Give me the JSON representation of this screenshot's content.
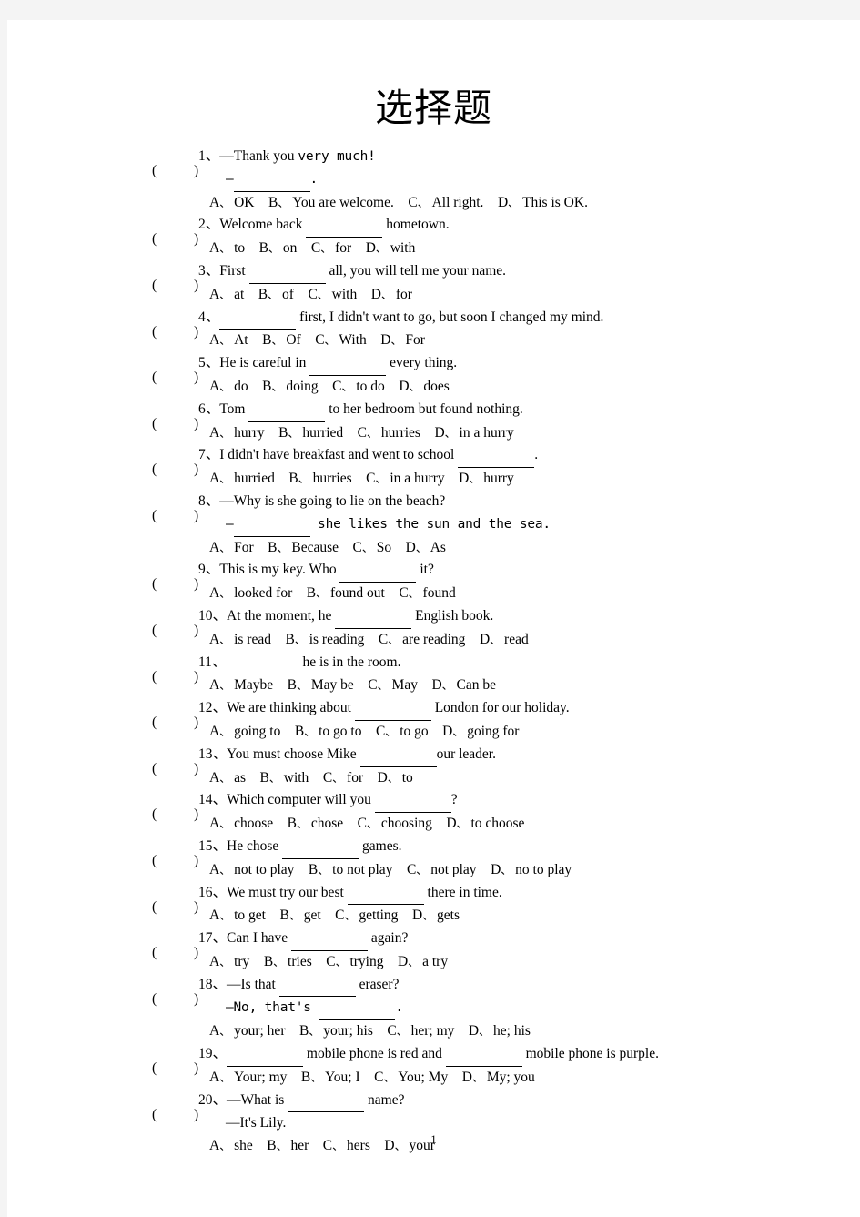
{
  "document": {
    "title": "选择题",
    "page_number": "1",
    "paren_left": "(",
    "paren_right": ")",
    "option_separator": "、"
  },
  "questions": [
    {
      "number": "1、",
      "stem": "—Thank you ",
      "stem_mono": "very much!",
      "continuation_prefix": "—",
      "continuation_suffix": ".",
      "options": [
        {
          "letter": "A",
          "text": "OK"
        },
        {
          "letter": "B",
          "text": "You are welcome."
        },
        {
          "letter": "C",
          "text": "All right."
        },
        {
          "letter": "D",
          "text": "This is OK."
        }
      ]
    },
    {
      "number": "2、",
      "stem_before": "Welcome back ",
      "stem_after": " hometown.",
      "options": [
        {
          "letter": "A",
          "text": "to"
        },
        {
          "letter": "B",
          "text": "on"
        },
        {
          "letter": "C",
          "text": "for"
        },
        {
          "letter": "D",
          "text": "with"
        }
      ]
    },
    {
      "number": "3、",
      "stem_before": "First ",
      "stem_after": " all, you will tell me your name.",
      "options": [
        {
          "letter": "A",
          "text": "at"
        },
        {
          "letter": "B",
          "text": "of"
        },
        {
          "letter": "C",
          "text": "with"
        },
        {
          "letter": "D",
          "text": "for"
        }
      ]
    },
    {
      "number": "4、",
      "stem_before": "",
      "stem_after": " first, I didn't want to go, but soon I changed my mind.",
      "options": [
        {
          "letter": "A",
          "text": "At"
        },
        {
          "letter": "B",
          "text": "Of"
        },
        {
          "letter": "C",
          "text": "With"
        },
        {
          "letter": "D",
          "text": "For"
        }
      ]
    },
    {
      "number": "5、",
      "stem_before": "He is careful in ",
      "stem_after": " every thing.",
      "options": [
        {
          "letter": "A",
          "text": "do"
        },
        {
          "letter": "B",
          "text": "doing"
        },
        {
          "letter": "C",
          "text": "to do"
        },
        {
          "letter": "D",
          "text": "does"
        }
      ]
    },
    {
      "number": "6、",
      "stem_before": "Tom ",
      "stem_after": " to her bedroom but found nothing.",
      "options": [
        {
          "letter": "A",
          "text": "hurry"
        },
        {
          "letter": "B",
          "text": "hurried"
        },
        {
          "letter": "C",
          "text": "hurries"
        },
        {
          "letter": "D",
          "text": "in a hurry"
        }
      ]
    },
    {
      "number": "7、",
      "stem_before": "I didn't have breakfast and went to school ",
      "stem_after": ".",
      "options": [
        {
          "letter": "A",
          "text": "hurried"
        },
        {
          "letter": "B",
          "text": "hurries"
        },
        {
          "letter": "C",
          "text": "in a hurry"
        },
        {
          "letter": "D",
          "text": "hurry"
        }
      ]
    },
    {
      "number": "8、",
      "stem": "—Why is she going to lie on the beach?",
      "continuation_prefix": "—",
      "continuation_suffix": " she likes the sun and the sea.",
      "options": [
        {
          "letter": "A",
          "text": "For"
        },
        {
          "letter": "B",
          "text": "Because"
        },
        {
          "letter": "C",
          "text": "So"
        },
        {
          "letter": "D",
          "text": "As"
        }
      ]
    },
    {
      "number": "9、",
      "stem_before": "This is my key. Who ",
      "stem_after": " it?",
      "options": [
        {
          "letter": "A",
          "text": "looked for"
        },
        {
          "letter": "B",
          "text": "found out"
        },
        {
          "letter": "C",
          "text": "found"
        }
      ]
    },
    {
      "number": "10、",
      "stem_before": "At the moment, he ",
      "stem_after": " English book.",
      "options": [
        {
          "letter": "A",
          "text": "is read"
        },
        {
          "letter": "B",
          "text": "is reading"
        },
        {
          "letter": "C",
          "text": "are reading"
        },
        {
          "letter": "D",
          "text": "read"
        }
      ]
    },
    {
      "number": "11、",
      "stem_before": "",
      "stem_after": "he is in the room.",
      "options": [
        {
          "letter": "A",
          "text": "Maybe"
        },
        {
          "letter": "B",
          "text": "May be"
        },
        {
          "letter": "C",
          "text": "May"
        },
        {
          "letter": "D",
          "text": "Can be"
        }
      ]
    },
    {
      "number": "12、",
      "stem_before": "We are thinking about ",
      "stem_after": " London for our holiday.",
      "options": [
        {
          "letter": "A",
          "text": "going to"
        },
        {
          "letter": "B",
          "text": "to go to"
        },
        {
          "letter": "C",
          "text": "to go"
        },
        {
          "letter": "D",
          "text": "going for"
        }
      ]
    },
    {
      "number": "13、",
      "stem_before": "You must choose Mike ",
      "stem_after": "our leader.",
      "options": [
        {
          "letter": "A",
          "text": "as"
        },
        {
          "letter": "B",
          "text": "with"
        },
        {
          "letter": "C",
          "text": "for"
        },
        {
          "letter": "D",
          "text": "to"
        }
      ]
    },
    {
      "number": "14、",
      "stem_before": "Which computer will you ",
      "stem_after": "?",
      "options": [
        {
          "letter": "A",
          "text": "choose"
        },
        {
          "letter": "B",
          "text": "chose"
        },
        {
          "letter": "C",
          "text": "choosing"
        },
        {
          "letter": "D",
          "text": "to choose"
        }
      ]
    },
    {
      "number": "15、",
      "stem_before": "He chose ",
      "stem_after": " games.",
      "options": [
        {
          "letter": "A",
          "text": "not to play"
        },
        {
          "letter": "B",
          "text": "to not play"
        },
        {
          "letter": "C",
          "text": "not play"
        },
        {
          "letter": "D",
          "text": "no to play"
        }
      ]
    },
    {
      "number": "16、",
      "stem_before": "We must try our best ",
      "stem_after": " there in time.",
      "options": [
        {
          "letter": "A",
          "text": "to get"
        },
        {
          "letter": "B",
          "text": "get"
        },
        {
          "letter": "C",
          "text": "getting"
        },
        {
          "letter": "D",
          "text": "gets"
        }
      ]
    },
    {
      "number": "17、",
      "stem_before": "Can I have ",
      "stem_after": " again?",
      "options": [
        {
          "letter": "A",
          "text": "try"
        },
        {
          "letter": "B",
          "text": "tries"
        },
        {
          "letter": "C",
          "text": "trying"
        },
        {
          "letter": "D",
          "text": "a try"
        }
      ]
    },
    {
      "number": "18、",
      "stem_before": "—Is that ",
      "stem_after": " eraser?",
      "continuation_prefix": "—No, that's ",
      "continuation_suffix": ".",
      "options": [
        {
          "letter": "A",
          "text": "your; her"
        },
        {
          "letter": "B",
          "text": "your; his"
        },
        {
          "letter": "C",
          "text": "her; my"
        },
        {
          "letter": "D",
          "text": "he; his"
        }
      ]
    },
    {
      "number": "19、",
      "stem_before": "",
      "stem_middle": " mobile phone is red and ",
      "stem_after": " mobile phone is purple.",
      "options": [
        {
          "letter": "A",
          "text": "Your; my"
        },
        {
          "letter": "B",
          "text": "You; I"
        },
        {
          "letter": "C",
          "text": "You; My"
        },
        {
          "letter": "D",
          "text": "My; you"
        }
      ]
    },
    {
      "number": "20、",
      "stem_before": "—What is ",
      "stem_after": " name?",
      "continuation": "—It's Lily.",
      "options": [
        {
          "letter": "A",
          "text": "she"
        },
        {
          "letter": "B",
          "text": "her"
        },
        {
          "letter": "C",
          "text": "hers"
        },
        {
          "letter": "D",
          "text": "your"
        }
      ]
    }
  ]
}
